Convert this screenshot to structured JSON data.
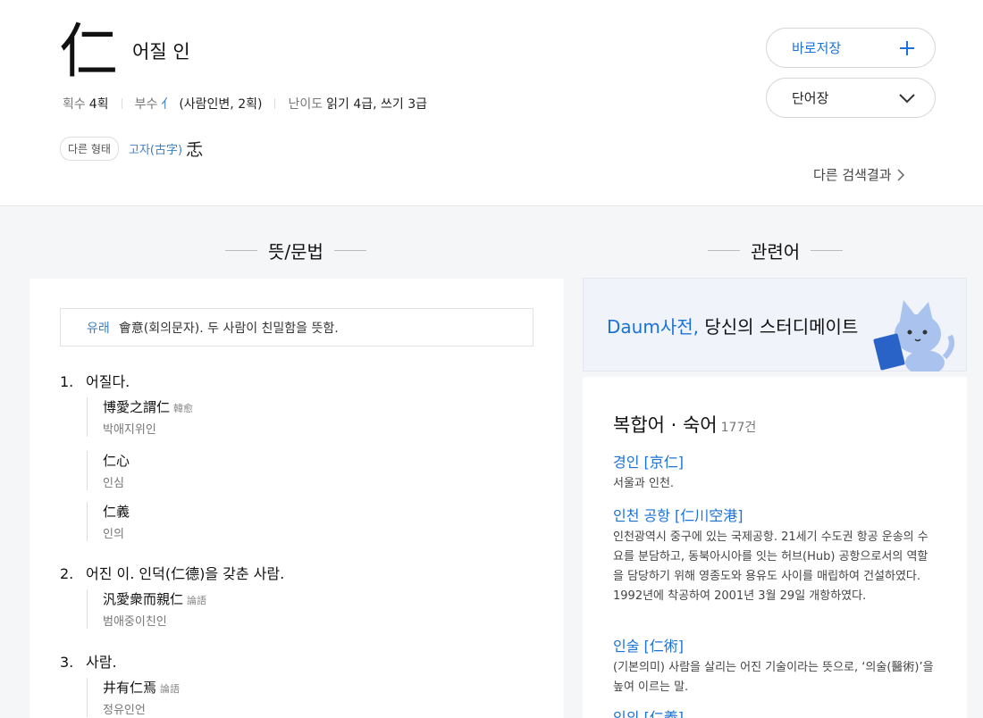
{
  "entry": {
    "character": "仁",
    "reading": "어질 인",
    "stroke_label": "획수",
    "stroke_value": "4획",
    "radical_label": "부수",
    "radical_char": "亻",
    "radical_desc": "(사람인변, 2획)",
    "level_label": "난이도",
    "level_value": "읽기 4급, 쓰기 3급",
    "alt_badge": "다른 형태",
    "alt_old_label": "고자(古字)",
    "alt_old_char": "忎"
  },
  "actions": {
    "save_label": "바로저장",
    "vocab_label": "단어장",
    "other_results": "다른 검색결과"
  },
  "sections": {
    "meaning_title": "뜻/문법",
    "related_title": "관련어"
  },
  "origin": {
    "label": "유래",
    "text": "會意(회의문자). 두 사람이 친밀함을 뜻함."
  },
  "meanings": [
    {
      "num": "1.",
      "text": "어질다.",
      "examples": [
        {
          "hanja": "博愛之謂仁",
          "source": "韓愈",
          "reading": "박애지위인"
        },
        {
          "hanja": "仁心",
          "source": "",
          "reading": "인심"
        },
        {
          "hanja": "仁義",
          "source": "",
          "reading": "인의"
        }
      ]
    },
    {
      "num": "2.",
      "text": "어진 이. 인덕(仁德)을 갖춘 사람.",
      "examples": [
        {
          "hanja": "汎愛衆而親仁",
          "source": "論語",
          "reading": "범애중이친인"
        }
      ]
    },
    {
      "num": "3.",
      "text": "사람.",
      "examples": [
        {
          "hanja": "井有仁焉",
          "source": "論語",
          "reading": "정유인언"
        }
      ]
    }
  ],
  "banner": {
    "brand": "Daum사전,",
    "tagline": " 당신의 스터디메이트"
  },
  "related": {
    "heading": "복합어 · 숙어",
    "count": "177건",
    "items": [
      {
        "word": "경인 [京仁]",
        "desc": "서울과 인천."
      },
      {
        "word": "인천 공항 [仁川空港]",
        "desc": "인천광역시 중구에 있는 국제공항. 21세기 수도권 항공 운송의 수요를 분담하고, 동북아시아를 잇는 허브(Hub) 공항으로서의 역할을 담당하기 위해 영종도와 용유도 사이를 매립하여 건설하였다. 1992년에 착공하여 2001년 3월 29일 개항하였다."
      },
      {
        "word": "인술 [仁術]",
        "desc": "(기본의미) 사람을 살리는 어진 기술이라는 뜻으로, ‘의술(醫術)’을 높여 이르는 말."
      },
      {
        "word": "인의 [仁義]",
        "desc": ""
      }
    ]
  },
  "colors": {
    "accent": "#1a72d9",
    "link": "#3b7fc4",
    "background": "#f5f6f7"
  }
}
